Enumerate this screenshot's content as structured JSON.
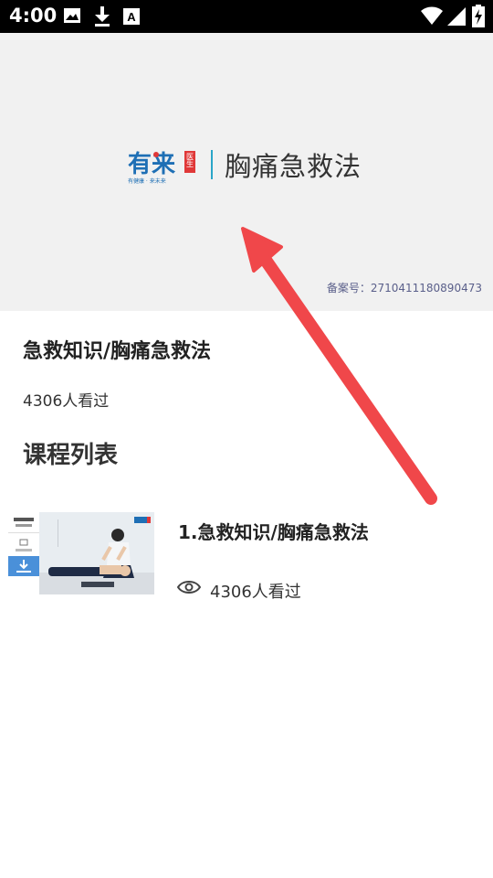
{
  "status_bar": {
    "time": "4:00",
    "icons": [
      "image-icon",
      "download-icon",
      "text-a-icon",
      "wifi-icon",
      "signal-icon",
      "battery-charging-icon"
    ]
  },
  "banner": {
    "brand_text": "有来",
    "brand_badge": "医生",
    "brand_tagline": "有健康 · 来未来",
    "title": "胸痛急救法",
    "record_number": "备案号：2710411180890473"
  },
  "course": {
    "title": "急救知识/胸痛急救法",
    "viewers": "4306人看过"
  },
  "section": {
    "title": "课程列表"
  },
  "list": [
    {
      "title": "1.急救知识/胸痛急救法",
      "viewers": "4306人看过"
    }
  ],
  "colors": {
    "status_bar": "#000000",
    "banner_bg": "#f1f1f1",
    "brand_blue": "#1e6fb5",
    "brand_red": "#e03838",
    "arrow_red": "#f0474a",
    "record_text": "#5a5f8a"
  }
}
